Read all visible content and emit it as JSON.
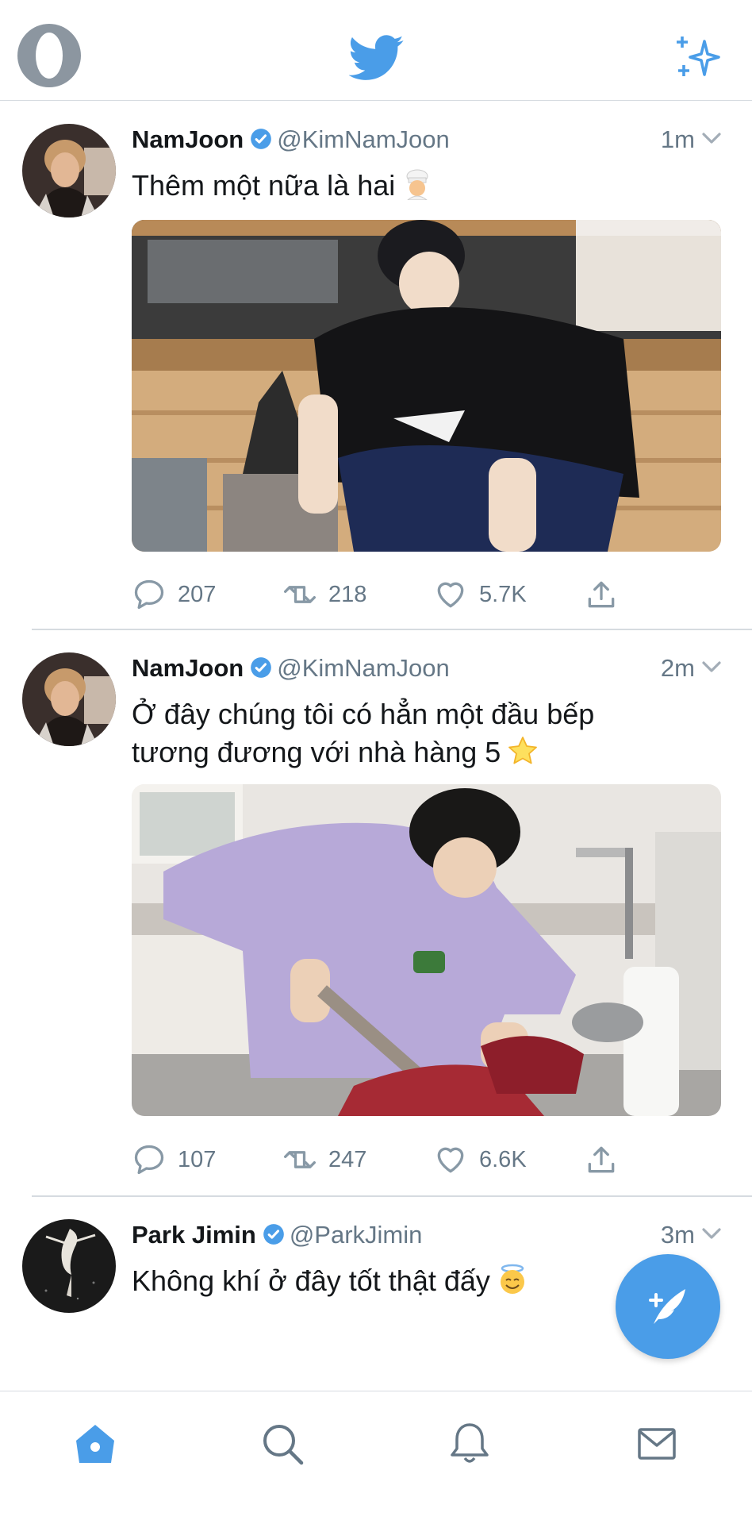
{
  "app": {
    "accent": "#4a9de8",
    "icons": [
      "profile-avatar-icon",
      "twitter-bird-icon",
      "sparkle-icon"
    ]
  },
  "tweets": [
    {
      "name": "NamJoon",
      "handle": "@KimNamJoon",
      "time": "1m",
      "text": "Thêm một nữa là hai",
      "emoji": "cook-emoji",
      "replies": "207",
      "retweets": "218",
      "likes": "5.7K"
    },
    {
      "name": "NamJoon",
      "handle": "@KimNamJoon",
      "time": "2m",
      "text_line1": "Ở đây chúng tôi có hẳn một đầu bếp",
      "text_line2": "tương đương với nhà hàng 5",
      "emoji": "star-emoji",
      "replies": "107",
      "retweets": "247",
      "likes": "6.6K"
    },
    {
      "name": "Park Jimin",
      "handle": "@ParkJimin",
      "time": "3m",
      "text": "Không khí ở đây tốt thật đấy",
      "emoji": "smiling-face-with-halo-emoji"
    }
  ],
  "bottom_nav": [
    "home-icon",
    "search-icon",
    "notifications-icon",
    "messages-icon"
  ]
}
